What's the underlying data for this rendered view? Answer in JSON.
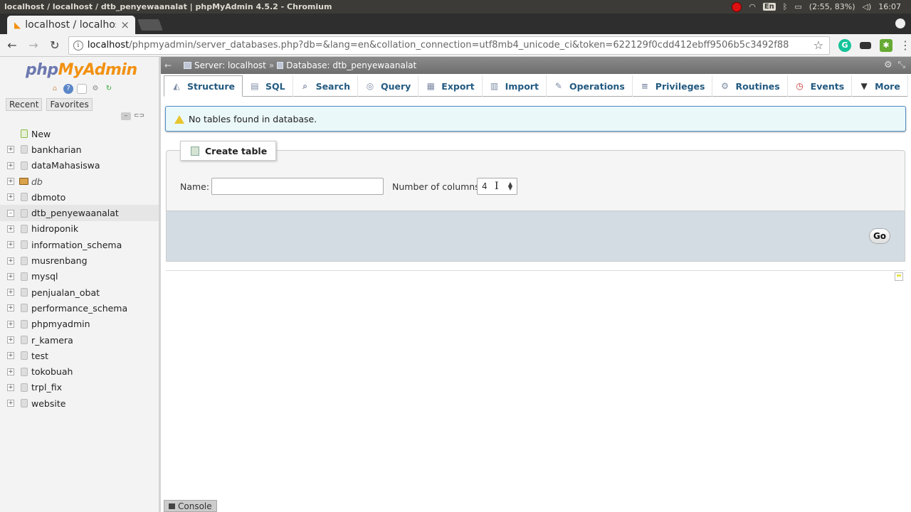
{
  "os": {
    "window_title": "localhost / localhost / dtb_penyewaanalat | phpMyAdmin 4.5.2 - Chromium",
    "battery": "(2:55, 83%)",
    "keyboard": "En",
    "clock": "16:07"
  },
  "browser": {
    "tab_title": "localhost / localhos",
    "tab_close": "×",
    "url_host": "localhost",
    "url_rest": "/phpmyadmin/server_databases.php?db=&lang=en&collation_connection=utf8mb4_unicode_ci&token=622129f0cdd412ebff9506b5c3492f88"
  },
  "sidebar": {
    "logo_php": "php",
    "logo_myadmin": "MyAdmin",
    "recent_label": "Recent",
    "favorites_label": "Favorites",
    "new_label": "New",
    "databases": [
      {
        "name": "bankharian"
      },
      {
        "name": "dataMahasiswa"
      },
      {
        "name": "db"
      },
      {
        "name": "dbmoto"
      },
      {
        "name": "dtb_penyewaanalat"
      },
      {
        "name": "hidroponik"
      },
      {
        "name": "information_schema"
      },
      {
        "name": "musrenbang"
      },
      {
        "name": "mysql"
      },
      {
        "name": "penjualan_obat"
      },
      {
        "name": "performance_schema"
      },
      {
        "name": "phpmyadmin"
      },
      {
        "name": "r_kamera"
      },
      {
        "name": "test"
      },
      {
        "name": "tokobuah"
      },
      {
        "name": "trpl_fix"
      },
      {
        "name": "website"
      }
    ]
  },
  "breadcrumb": {
    "server": "Server: localhost",
    "separator": "»",
    "database": "Database: dtb_penyewaanalat"
  },
  "tabs": [
    {
      "label": "Structure",
      "icon": "structure-icon",
      "active": true
    },
    {
      "label": "SQL",
      "icon": "sql-icon"
    },
    {
      "label": "Search",
      "icon": "search-icon"
    },
    {
      "label": "Query",
      "icon": "query-icon"
    },
    {
      "label": "Export",
      "icon": "export-icon"
    },
    {
      "label": "Import",
      "icon": "import-icon"
    },
    {
      "label": "Operations",
      "icon": "wrench-icon"
    },
    {
      "label": "Privileges",
      "icon": "privileges-icon"
    },
    {
      "label": "Routines",
      "icon": "routines-icon"
    },
    {
      "label": "Events",
      "icon": "clock-icon"
    },
    {
      "label": "More",
      "icon": "chevron-down-icon"
    }
  ],
  "notice": {
    "text": "No tables found in database."
  },
  "create_table": {
    "legend": "Create table",
    "name_label": "Name:",
    "name_value": "",
    "columns_label": "Number of columns:",
    "columns_value": "4",
    "go_label": "Go"
  },
  "console": {
    "label": "Console"
  },
  "colors": {
    "accent_link": "#235a81",
    "logo_php": "#6c78af",
    "logo_myadmin": "#f29111",
    "notice_bg": "#ebf8fa",
    "footer_bg": "#d3dce3"
  }
}
